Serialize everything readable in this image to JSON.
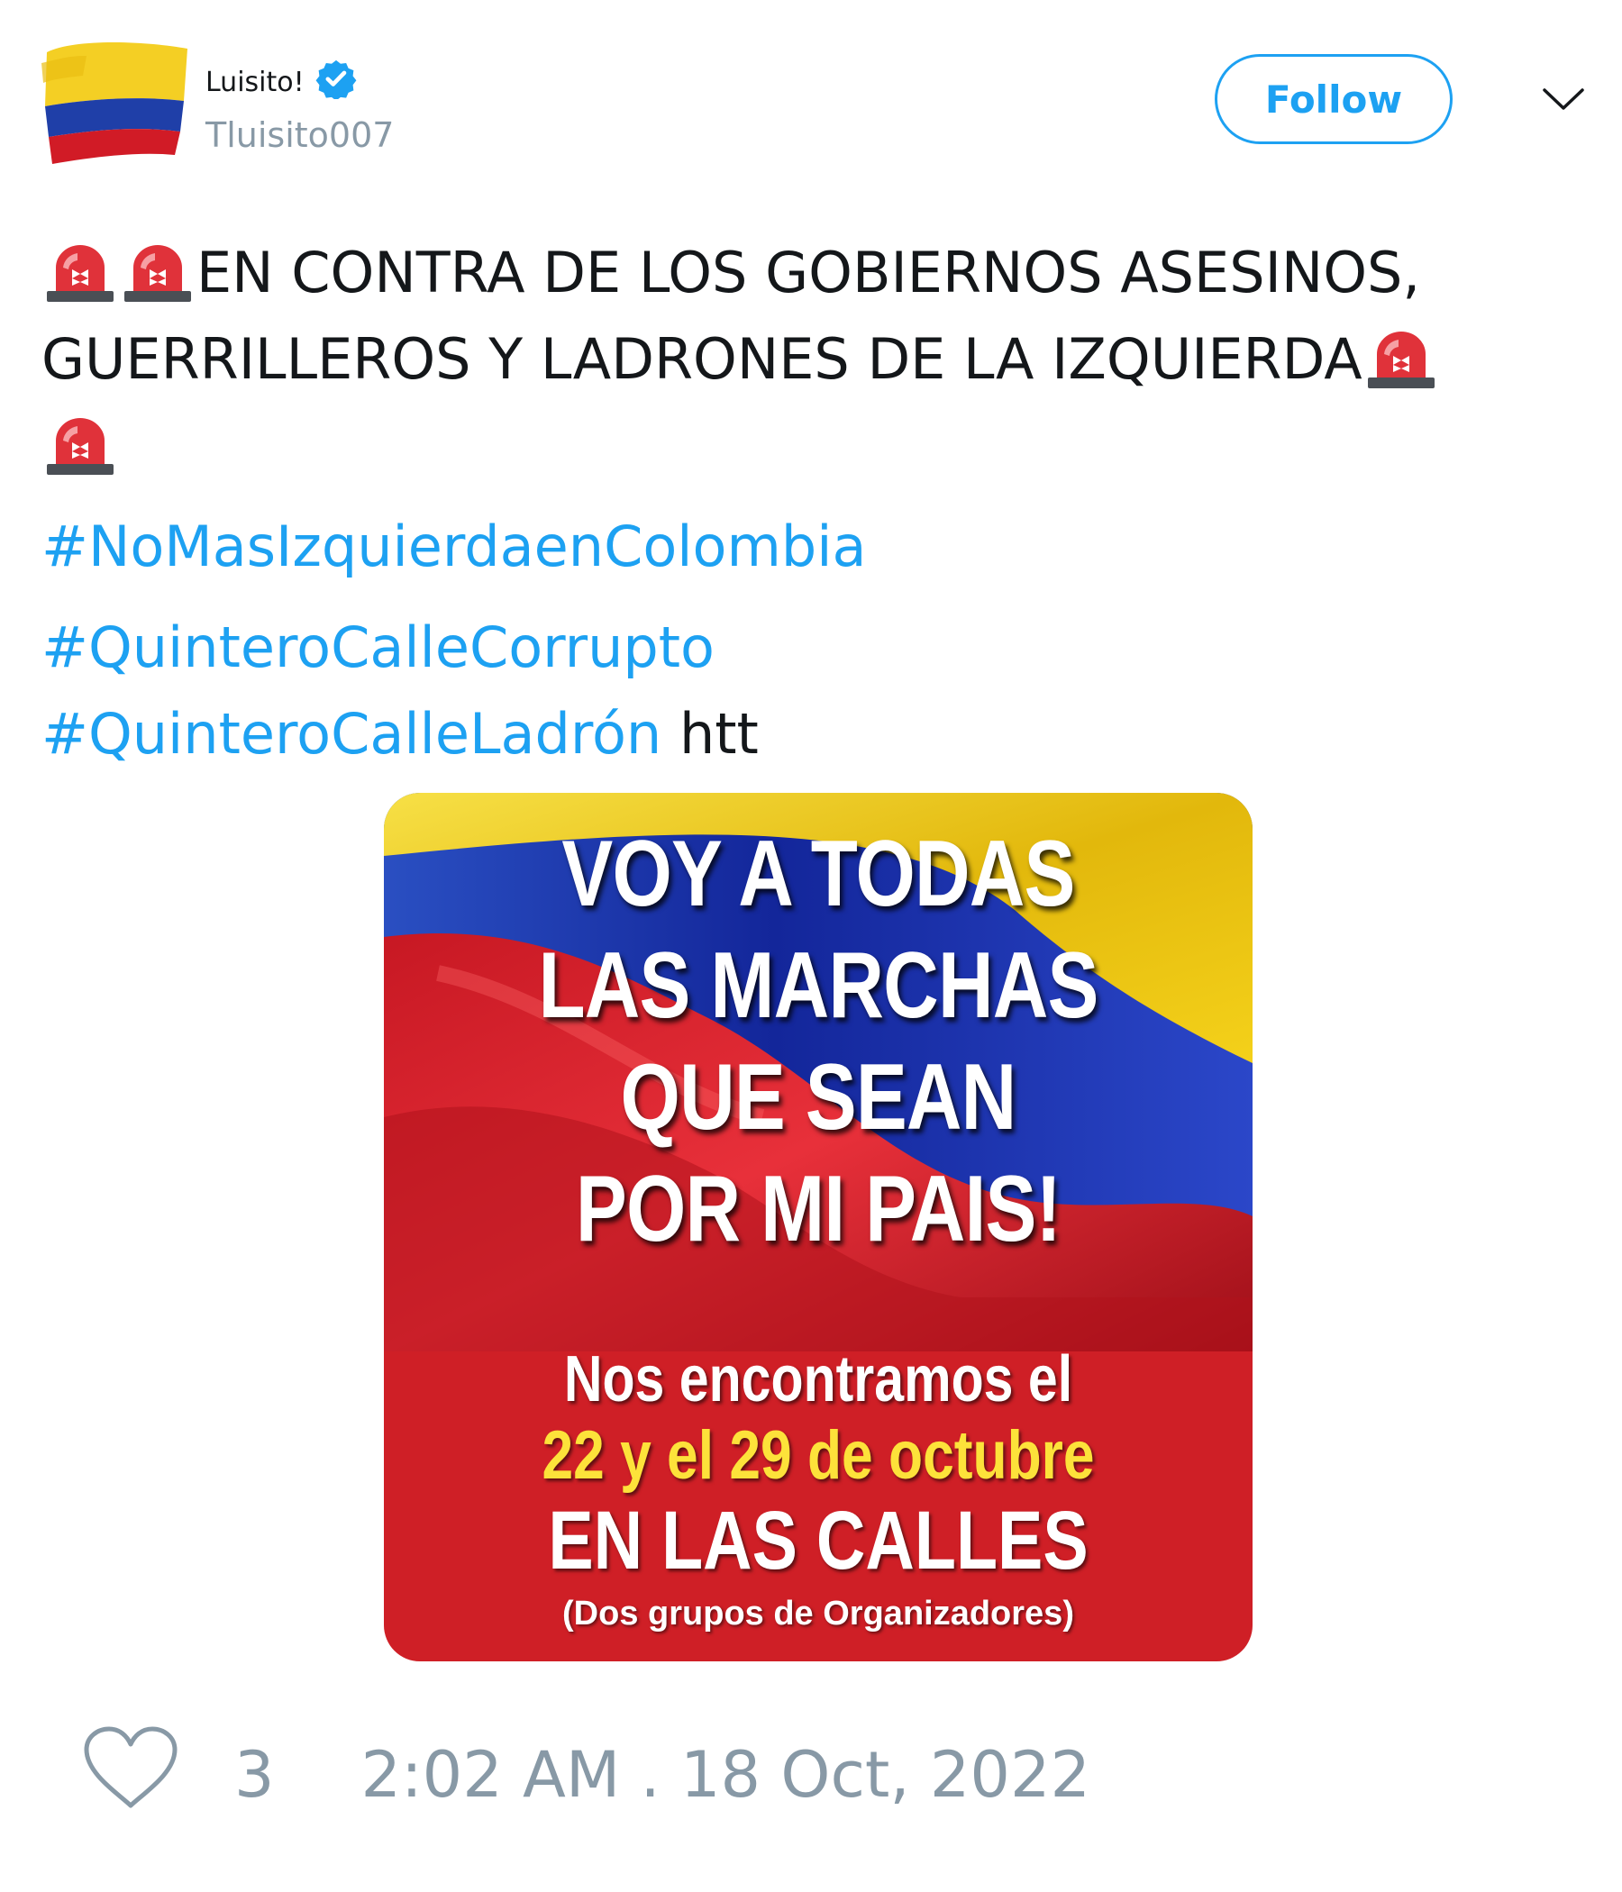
{
  "user": {
    "display_name": "Luisito!",
    "handle": "Tluisito007",
    "verified_icon": "verified-badge-icon",
    "avatar_icon": "colombia-flag-avatar"
  },
  "actions": {
    "follow_label": "Follow",
    "menu_icon": "chevron-down-icon"
  },
  "tweet": {
    "line1": "EN CONTRA DE LOS GOBIERNOS ASESINOS,",
    "line2": "GUERRILLEROS Y LADRONES DE LA IZQUIERDA",
    "hashtag1": "#NoMasIzquierdaenColombia",
    "hashtag2": "#QuinteroCalleCorrupto",
    "hashtag3": "#QuinteroCalleLadrón",
    "trailing": "htt",
    "emoji_icon": "police-siren-icon"
  },
  "media": {
    "headline_1": "VOY A TODAS",
    "headline_2": "LAS MARCHAS",
    "headline_3": "QUE SEAN",
    "headline_4": "POR MI PAIS!",
    "sub_1": "Nos encontramos el",
    "sub_2": "22 y el 29 de octubre",
    "sub_3": "EN LAS CALLES",
    "sub_4": "(Dos grupos de Organizadores)"
  },
  "footer": {
    "like_icon": "heart-icon",
    "like_count": "3",
    "timestamp": "2:02 AM . 18 Oct, 2022"
  },
  "colors": {
    "accent": "#1da1f2",
    "muted": "#8899a6",
    "text": "#14171a",
    "flag_yellow": "#f4d11a",
    "flag_blue": "#1f3fa8",
    "flag_red": "#d11b26"
  }
}
